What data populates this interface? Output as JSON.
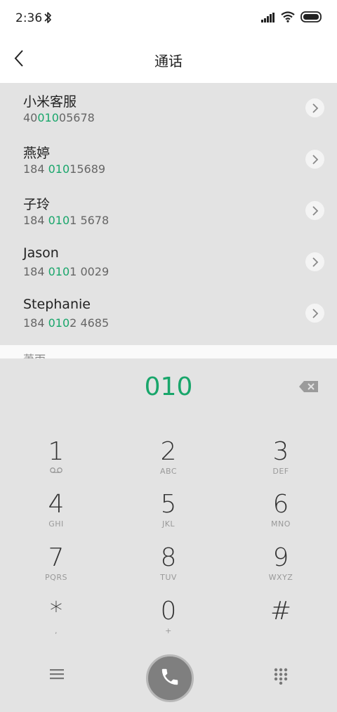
{
  "status": {
    "time": "2:36"
  },
  "header": {
    "title": "通话"
  },
  "contacts": [
    {
      "name": "小米客服",
      "num_pre": "40",
      "num_hl": "010",
      "num_post": "05678"
    },
    {
      "name": "燕婷",
      "num_pre": "184 ",
      "num_hl": "010",
      "num_post": "15689"
    },
    {
      "name": "子玲",
      "num_pre": "184 ",
      "num_hl": "010",
      "num_post": "1 5678"
    },
    {
      "name": "Jason",
      "num_pre": "184 ",
      "num_hl": "010",
      "num_post": "1 0029"
    },
    {
      "name": "Stephanie",
      "num_pre": "184 ",
      "num_hl": "010",
      "num_post": "2 4685"
    }
  ],
  "partial_contact": "萧雨",
  "dialer": {
    "digits": "010",
    "keys": [
      {
        "digit": "1",
        "letters": ""
      },
      {
        "digit": "2",
        "letters": "ABC"
      },
      {
        "digit": "3",
        "letters": "DEF"
      },
      {
        "digit": "4",
        "letters": "GHI"
      },
      {
        "digit": "5",
        "letters": "JKL"
      },
      {
        "digit": "6",
        "letters": "MNO"
      },
      {
        "digit": "7",
        "letters": "PQRS"
      },
      {
        "digit": "8",
        "letters": "TUV"
      },
      {
        "digit": "9",
        "letters": "WXYZ"
      },
      {
        "digit": "*",
        "letters": ","
      },
      {
        "digit": "0",
        "letters": "+"
      },
      {
        "digit": "#",
        "letters": ""
      }
    ]
  },
  "colors": {
    "accent": "#19a66b",
    "pad_bg": "#e3e3e3",
    "call_button": "#7f7f7f"
  },
  "icons": [
    "bluetooth-icon",
    "signal-icon",
    "wifi-icon",
    "battery-icon",
    "back-icon",
    "chevron-right-icon",
    "backspace-icon",
    "voicemail-icon",
    "menu-icon",
    "call-icon",
    "keypad-icon"
  ]
}
